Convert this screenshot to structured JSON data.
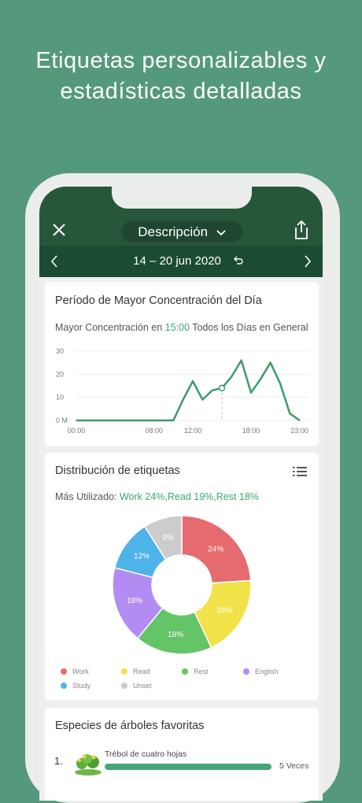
{
  "headline": {
    "line1": "Etiquetas personalizables y",
    "line2": "estadísticas detalladas"
  },
  "appbar": {
    "title": "Descripción",
    "close_icon": "close-icon",
    "share_icon": "share-icon",
    "background": "#27573b"
  },
  "datebar": {
    "range": "14 – 20 jun 2020",
    "prev_icon": "chevron-left-icon",
    "next_icon": "chevron-right-icon",
    "undo_icon": "undo-icon"
  },
  "concentration_card": {
    "title": "Período de Mayor Concentración del Día",
    "summary_prefix": "Mayor Concentración en",
    "summary_time": "15:00",
    "summary_suffix": "Todos los Días en General"
  },
  "tags_card": {
    "title": "Distribución de etiquetas",
    "summary_prefix": "Más Utilizado:",
    "summary_value": "Work 24%,Read 19%,Rest 18%",
    "list_icon": "list-icon"
  },
  "trees_card": {
    "title": "Especies de árboles favoritas",
    "items": [
      {
        "rank": "1.",
        "name": "Trébol de cuatro hojas",
        "count": "5 Veces"
      }
    ]
  },
  "chart_data": [
    {
      "type": "line",
      "title": "",
      "x_ticks": [
        "00:00",
        "08:00",
        "12:00",
        "18:00",
        "23:00"
      ],
      "y_ticks": [
        "0 M",
        "10",
        "20",
        "30"
      ],
      "ylim": [
        0,
        30
      ],
      "xlim": [
        0,
        24
      ],
      "grid": true,
      "highlight_hour": 15,
      "series": [
        {
          "color": "#3f9a6c",
          "x": [
            0,
            1,
            2,
            3,
            4,
            5,
            6,
            7,
            8,
            9,
            10,
            11,
            12,
            13,
            14,
            15,
            16,
            17,
            18,
            19,
            20,
            21,
            22,
            23
          ],
          "y": [
            0,
            0,
            0,
            0,
            0,
            0,
            0,
            0,
            0,
            0,
            0,
            9,
            17,
            9,
            13,
            14,
            19,
            26,
            12,
            18,
            25,
            16,
            3,
            0
          ]
        }
      ]
    },
    {
      "type": "pie",
      "labels": [
        "Work",
        "Read",
        "Rest",
        "English",
        "Study",
        "Unset"
      ],
      "values": [
        24,
        19,
        18,
        18,
        12,
        9
      ],
      "value_labels": [
        "24%",
        "19%",
        "18%",
        "18%",
        "12%",
        "9%"
      ],
      "colors": [
        "#e56b6f",
        "#f1e24a",
        "#64c466",
        "#b38cf3",
        "#4eb3e8",
        "#cccccc"
      ],
      "legend": "bottom"
    }
  ]
}
